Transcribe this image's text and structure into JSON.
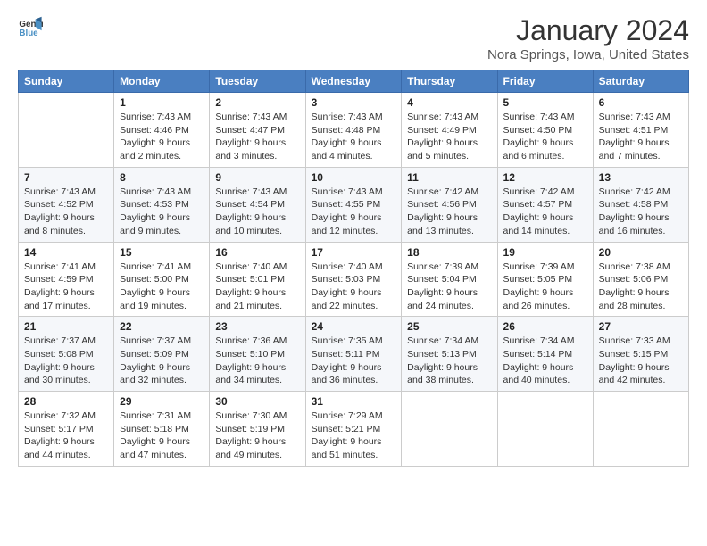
{
  "header": {
    "logo_line1": "General",
    "logo_line2": "Blue",
    "month_title": "January 2024",
    "location": "Nora Springs, Iowa, United States"
  },
  "days_of_week": [
    "Sunday",
    "Monday",
    "Tuesday",
    "Wednesday",
    "Thursday",
    "Friday",
    "Saturday"
  ],
  "weeks": [
    [
      {
        "day": "",
        "sunrise": "",
        "sunset": "",
        "daylight": ""
      },
      {
        "day": "1",
        "sunrise": "Sunrise: 7:43 AM",
        "sunset": "Sunset: 4:46 PM",
        "daylight": "Daylight: 9 hours and 2 minutes."
      },
      {
        "day": "2",
        "sunrise": "Sunrise: 7:43 AM",
        "sunset": "Sunset: 4:47 PM",
        "daylight": "Daylight: 9 hours and 3 minutes."
      },
      {
        "day": "3",
        "sunrise": "Sunrise: 7:43 AM",
        "sunset": "Sunset: 4:48 PM",
        "daylight": "Daylight: 9 hours and 4 minutes."
      },
      {
        "day": "4",
        "sunrise": "Sunrise: 7:43 AM",
        "sunset": "Sunset: 4:49 PM",
        "daylight": "Daylight: 9 hours and 5 minutes."
      },
      {
        "day": "5",
        "sunrise": "Sunrise: 7:43 AM",
        "sunset": "Sunset: 4:50 PM",
        "daylight": "Daylight: 9 hours and 6 minutes."
      },
      {
        "day": "6",
        "sunrise": "Sunrise: 7:43 AM",
        "sunset": "Sunset: 4:51 PM",
        "daylight": "Daylight: 9 hours and 7 minutes."
      }
    ],
    [
      {
        "day": "7",
        "sunrise": "Sunrise: 7:43 AM",
        "sunset": "Sunset: 4:52 PM",
        "daylight": "Daylight: 9 hours and 8 minutes."
      },
      {
        "day": "8",
        "sunrise": "Sunrise: 7:43 AM",
        "sunset": "Sunset: 4:53 PM",
        "daylight": "Daylight: 9 hours and 9 minutes."
      },
      {
        "day": "9",
        "sunrise": "Sunrise: 7:43 AM",
        "sunset": "Sunset: 4:54 PM",
        "daylight": "Daylight: 9 hours and 10 minutes."
      },
      {
        "day": "10",
        "sunrise": "Sunrise: 7:43 AM",
        "sunset": "Sunset: 4:55 PM",
        "daylight": "Daylight: 9 hours and 12 minutes."
      },
      {
        "day": "11",
        "sunrise": "Sunrise: 7:42 AM",
        "sunset": "Sunset: 4:56 PM",
        "daylight": "Daylight: 9 hours and 13 minutes."
      },
      {
        "day": "12",
        "sunrise": "Sunrise: 7:42 AM",
        "sunset": "Sunset: 4:57 PM",
        "daylight": "Daylight: 9 hours and 14 minutes."
      },
      {
        "day": "13",
        "sunrise": "Sunrise: 7:42 AM",
        "sunset": "Sunset: 4:58 PM",
        "daylight": "Daylight: 9 hours and 16 minutes."
      }
    ],
    [
      {
        "day": "14",
        "sunrise": "Sunrise: 7:41 AM",
        "sunset": "Sunset: 4:59 PM",
        "daylight": "Daylight: 9 hours and 17 minutes."
      },
      {
        "day": "15",
        "sunrise": "Sunrise: 7:41 AM",
        "sunset": "Sunset: 5:00 PM",
        "daylight": "Daylight: 9 hours and 19 minutes."
      },
      {
        "day": "16",
        "sunrise": "Sunrise: 7:40 AM",
        "sunset": "Sunset: 5:01 PM",
        "daylight": "Daylight: 9 hours and 21 minutes."
      },
      {
        "day": "17",
        "sunrise": "Sunrise: 7:40 AM",
        "sunset": "Sunset: 5:03 PM",
        "daylight": "Daylight: 9 hours and 22 minutes."
      },
      {
        "day": "18",
        "sunrise": "Sunrise: 7:39 AM",
        "sunset": "Sunset: 5:04 PM",
        "daylight": "Daylight: 9 hours and 24 minutes."
      },
      {
        "day": "19",
        "sunrise": "Sunrise: 7:39 AM",
        "sunset": "Sunset: 5:05 PM",
        "daylight": "Daylight: 9 hours and 26 minutes."
      },
      {
        "day": "20",
        "sunrise": "Sunrise: 7:38 AM",
        "sunset": "Sunset: 5:06 PM",
        "daylight": "Daylight: 9 hours and 28 minutes."
      }
    ],
    [
      {
        "day": "21",
        "sunrise": "Sunrise: 7:37 AM",
        "sunset": "Sunset: 5:08 PM",
        "daylight": "Daylight: 9 hours and 30 minutes."
      },
      {
        "day": "22",
        "sunrise": "Sunrise: 7:37 AM",
        "sunset": "Sunset: 5:09 PM",
        "daylight": "Daylight: 9 hours and 32 minutes."
      },
      {
        "day": "23",
        "sunrise": "Sunrise: 7:36 AM",
        "sunset": "Sunset: 5:10 PM",
        "daylight": "Daylight: 9 hours and 34 minutes."
      },
      {
        "day": "24",
        "sunrise": "Sunrise: 7:35 AM",
        "sunset": "Sunset: 5:11 PM",
        "daylight": "Daylight: 9 hours and 36 minutes."
      },
      {
        "day": "25",
        "sunrise": "Sunrise: 7:34 AM",
        "sunset": "Sunset: 5:13 PM",
        "daylight": "Daylight: 9 hours and 38 minutes."
      },
      {
        "day": "26",
        "sunrise": "Sunrise: 7:34 AM",
        "sunset": "Sunset: 5:14 PM",
        "daylight": "Daylight: 9 hours and 40 minutes."
      },
      {
        "day": "27",
        "sunrise": "Sunrise: 7:33 AM",
        "sunset": "Sunset: 5:15 PM",
        "daylight": "Daylight: 9 hours and 42 minutes."
      }
    ],
    [
      {
        "day": "28",
        "sunrise": "Sunrise: 7:32 AM",
        "sunset": "Sunset: 5:17 PM",
        "daylight": "Daylight: 9 hours and 44 minutes."
      },
      {
        "day": "29",
        "sunrise": "Sunrise: 7:31 AM",
        "sunset": "Sunset: 5:18 PM",
        "daylight": "Daylight: 9 hours and 47 minutes."
      },
      {
        "day": "30",
        "sunrise": "Sunrise: 7:30 AM",
        "sunset": "Sunset: 5:19 PM",
        "daylight": "Daylight: 9 hours and 49 minutes."
      },
      {
        "day": "31",
        "sunrise": "Sunrise: 7:29 AM",
        "sunset": "Sunset: 5:21 PM",
        "daylight": "Daylight: 9 hours and 51 minutes."
      },
      {
        "day": "",
        "sunrise": "",
        "sunset": "",
        "daylight": ""
      },
      {
        "day": "",
        "sunrise": "",
        "sunset": "",
        "daylight": ""
      },
      {
        "day": "",
        "sunrise": "",
        "sunset": "",
        "daylight": ""
      }
    ]
  ]
}
